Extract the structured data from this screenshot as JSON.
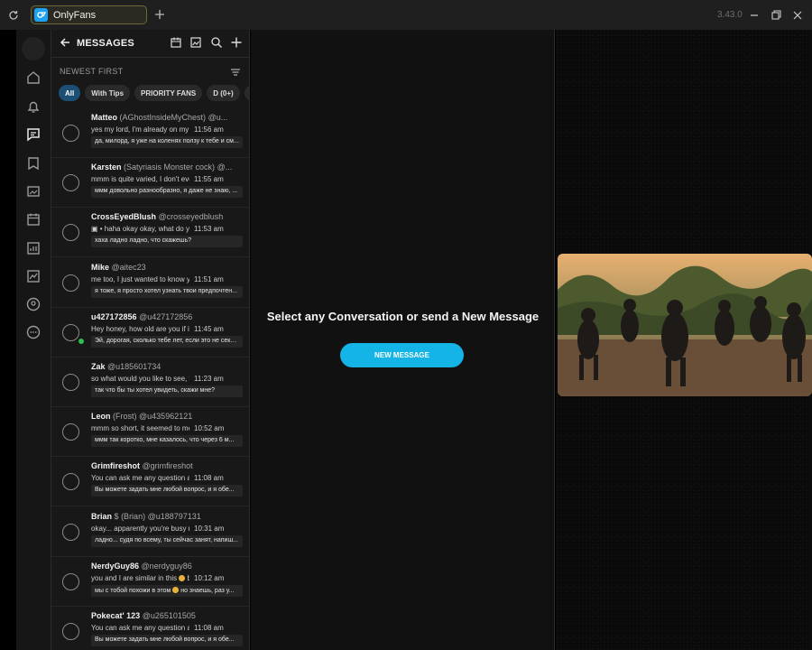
{
  "titlebar": {
    "tab_title": "OnlyFans",
    "version": "3.43.0"
  },
  "panel": {
    "title": "MESSAGES",
    "sort_label": "NEWEST FIRST",
    "chips": [
      "All",
      "With Tips",
      "PRIORITY FANS",
      "D (0+)",
      "C"
    ]
  },
  "conversations": [
    {
      "name": "Matteo",
      "display": "(AGhostInsideMyChest)",
      "handle": "@u...",
      "preview": "yes my lord, I'm already on my knees",
      "time": "11:56 am",
      "translation": "да, милорд, я уже на коленях ползу к тебе и см..."
    },
    {
      "name": "Karsten",
      "display": "(Satyriasis Monster cock)",
      "handle": "@...",
      "preview": "mmm is quite varied, I don't even know",
      "time": "11:55 am",
      "translation": "ммм довольно разнообразно, я даже не знаю, ..."
    },
    {
      "name": "CrossEyedBlush",
      "display": "",
      "handle": "@crosseyedblush",
      "preview": "▣ • haha okay okay, what do you say",
      "time": "11:53 am",
      "translation": "хаха ладно ладно, что скажешь?"
    },
    {
      "name": "Mike",
      "display": "",
      "handle": "@aitec23",
      "preview": "me too, I just wanted to know your p",
      "time": "11:51 am",
      "translation": "я тоже, я просто хотел узнать твои предпочтен..."
    },
    {
      "name": "u427172856",
      "display": "",
      "handle": "@u427172856",
      "preview": "Hey honey, how old are you if it's not",
      "time": "11:45 am",
      "translation": "Эй, дорогая, сколько тебе лет, если это не секр...",
      "online": true
    },
    {
      "name": "Zak",
      "display": "",
      "handle": "@u185601734",
      "preview": "so what would you like to see, tell m",
      "time": "11:23 am",
      "translation": "так что бы ты хотел увидеть, скажи мне?"
    },
    {
      "name": "Leon",
      "display": "(Frost)",
      "handle": "@u435962121",
      "preview": "mmm so short, it seemed to me that",
      "time": "10:52 am",
      "translation": "ммм так коротко, мне казалось, что через 6 м..."
    },
    {
      "name": "Grimfireshot",
      "display": "",
      "handle": "@grimfireshot",
      "preview": "You can ask me any question and I g",
      "time": "11:08 am",
      "translation": "Вы можете задать мне любой вопрос, и я обе..."
    },
    {
      "name": "Brian",
      "display": "(Brian)",
      "handle": "@u188797131",
      "preview": "okay... apparently you're busy right n",
      "time": "10:31 am",
      "translation": "ладно... судя по всему, ты сейчас занят, напиш...",
      "dollar": "$"
    },
    {
      "name": "NerdyGuy86",
      "display": "",
      "handle": "@nerdyguy86",
      "preview": "you and I are similar in this",
      "preview_suffix": "but y",
      "time": "10:12 am",
      "translation": "мы с тобой похожи в этом",
      "translation_suffix": "но знаешь, раз у...",
      "emoji": true
    },
    {
      "name": "Pokecat' 123",
      "display": "",
      "handle": "@u265101505",
      "preview": "You can ask me any question and I g",
      "time": "11:08 am",
      "translation": "Вы можете задать мне любой вопрос, и я обе..."
    }
  ],
  "center": {
    "prompt": "Select any Conversation or send a New Message",
    "button": "NEW MESSAGE"
  },
  "colors": {
    "accent": "#14b4e6",
    "online": "#2fbf4f",
    "chip_active": "#1c4f73"
  },
  "icons": [
    "refresh-icon",
    "onlyfans-logo-icon",
    "plus-icon",
    "minimize-icon",
    "restore-icon",
    "close-icon",
    "home-icon",
    "bell-icon",
    "chat-icon",
    "bookmark-icon",
    "media-icon",
    "calendar-icon",
    "stats-icon",
    "chart-icon",
    "user-circle-icon",
    "more-icon",
    "back-arrow-icon",
    "calendar-icon",
    "image-icon",
    "search-icon",
    "plus-icon",
    "sort-icon"
  ]
}
